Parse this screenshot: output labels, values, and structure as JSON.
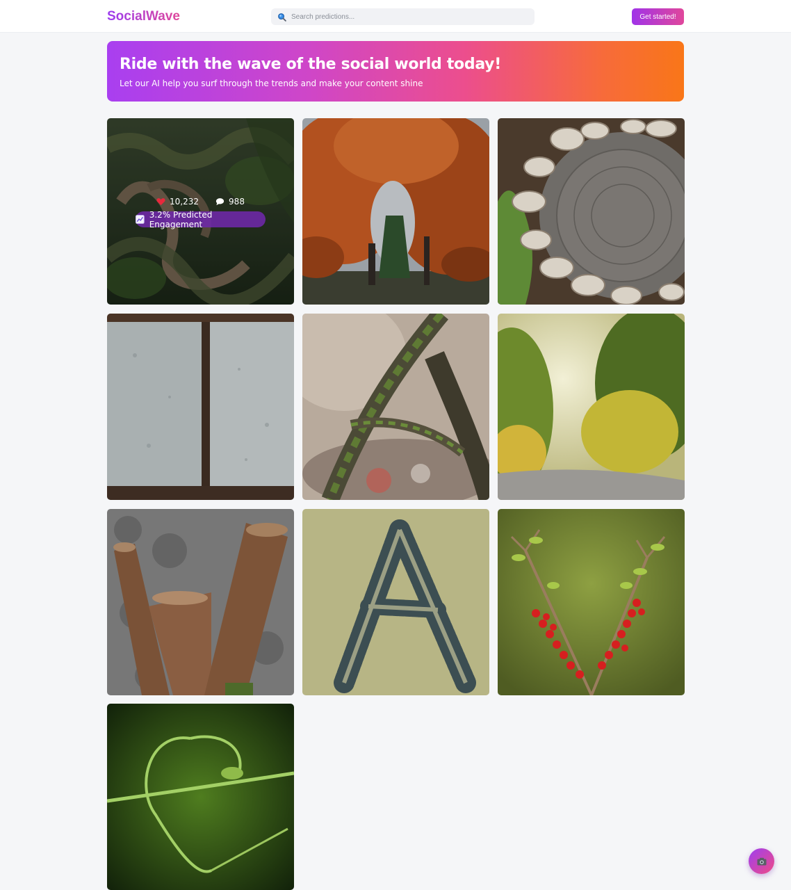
{
  "header": {
    "brand": "SocialWave",
    "search_placeholder": "Search predictions...",
    "cta_label": "Get started!"
  },
  "hero": {
    "title": "Ride with the wave of the social world today!",
    "subtitle": "Let our AI help you surf through the trends and make your content shine"
  },
  "posts": [
    {
      "alt": "Twisted tree roots in a forest",
      "likes": "10,232",
      "comments": "988",
      "engagement": "3.2% Predicted Engagement",
      "hovered": true
    },
    {
      "alt": "Autumn trees forming an arch over a road"
    },
    {
      "alt": "Bracket mushrooms around a tree stump"
    },
    {
      "alt": "Stone slabs with a rusty joint"
    },
    {
      "alt": "Mossy branches forming the letter A"
    },
    {
      "alt": "Sunlit country road through trees"
    },
    {
      "alt": "Cut tree trunks forming a V shape"
    },
    {
      "alt": "Letter A drawn in sand"
    },
    {
      "alt": "Red berries on branches forming a V"
    },
    {
      "alt": "Curling green vine tendril"
    }
  ],
  "colors": {
    "brand_gradient": [
      "#9b3cf0",
      "#e0489a"
    ],
    "hero_gradient": [
      "#a93ff0",
      "#ec4e8d",
      "#f97618"
    ],
    "page_bg": "#f5f6f8"
  },
  "icons": {
    "search": "search-icon",
    "likes": "heart-icon",
    "comments": "comment-icon",
    "engagement": "chart-icon",
    "fab": "camera-icon"
  }
}
